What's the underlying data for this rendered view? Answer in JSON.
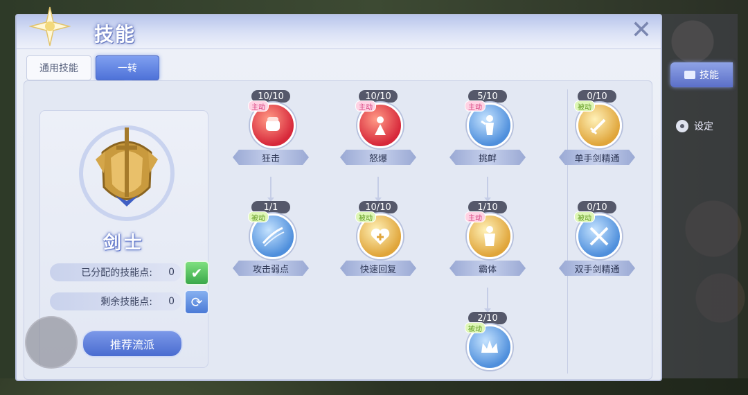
{
  "window": {
    "title": "技能",
    "close_icon": "close-x-icon"
  },
  "tabs": [
    {
      "label": "通用技能",
      "selected": false
    },
    {
      "label": "一转",
      "selected": true
    }
  ],
  "sidebar": {
    "skill_tab_label": "技能",
    "settings_label": "设定"
  },
  "class_panel": {
    "class_name": "剑士",
    "emblem_icon": "sword-shield-emblem-icon",
    "allocated_label": "已分配的技能点:",
    "allocated_value": "0",
    "remaining_label": "剩余技能点:",
    "remaining_value": "0",
    "recommend_label": "推荐流派"
  },
  "skills": [
    {
      "name": "狂击",
      "level": "10/10",
      "type": "主动",
      "color": "red",
      "icon": "fist-icon"
    },
    {
      "name": "怒爆",
      "level": "10/10",
      "type": "主动",
      "color": "red",
      "icon": "rage-burst-icon"
    },
    {
      "name": "挑衅",
      "level": "5/10",
      "type": "主动",
      "color": "blue",
      "icon": "taunt-figure-icon"
    },
    {
      "name": "单手剑精通",
      "level": "0/10",
      "type": "被动",
      "color": "gold",
      "icon": "one-hand-sword-icon"
    },
    {
      "name": "攻击弱点",
      "level": "1/1",
      "type": "被动",
      "color": "blue",
      "icon": "slash-icon"
    },
    {
      "name": "快速回复",
      "level": "10/10",
      "type": "被动",
      "color": "gold",
      "icon": "heart-plus-icon"
    },
    {
      "name": "霸体",
      "level": "1/10",
      "type": "主动",
      "color": "gold",
      "icon": "body-aura-icon"
    },
    {
      "name": "双手剑精通",
      "level": "0/10",
      "type": "被动",
      "color": "blue",
      "icon": "two-hand-sword-icon"
    },
    {
      "name": "",
      "level": "2/10",
      "type": "被动",
      "color": "blue",
      "icon": "crown-icon"
    }
  ]
}
